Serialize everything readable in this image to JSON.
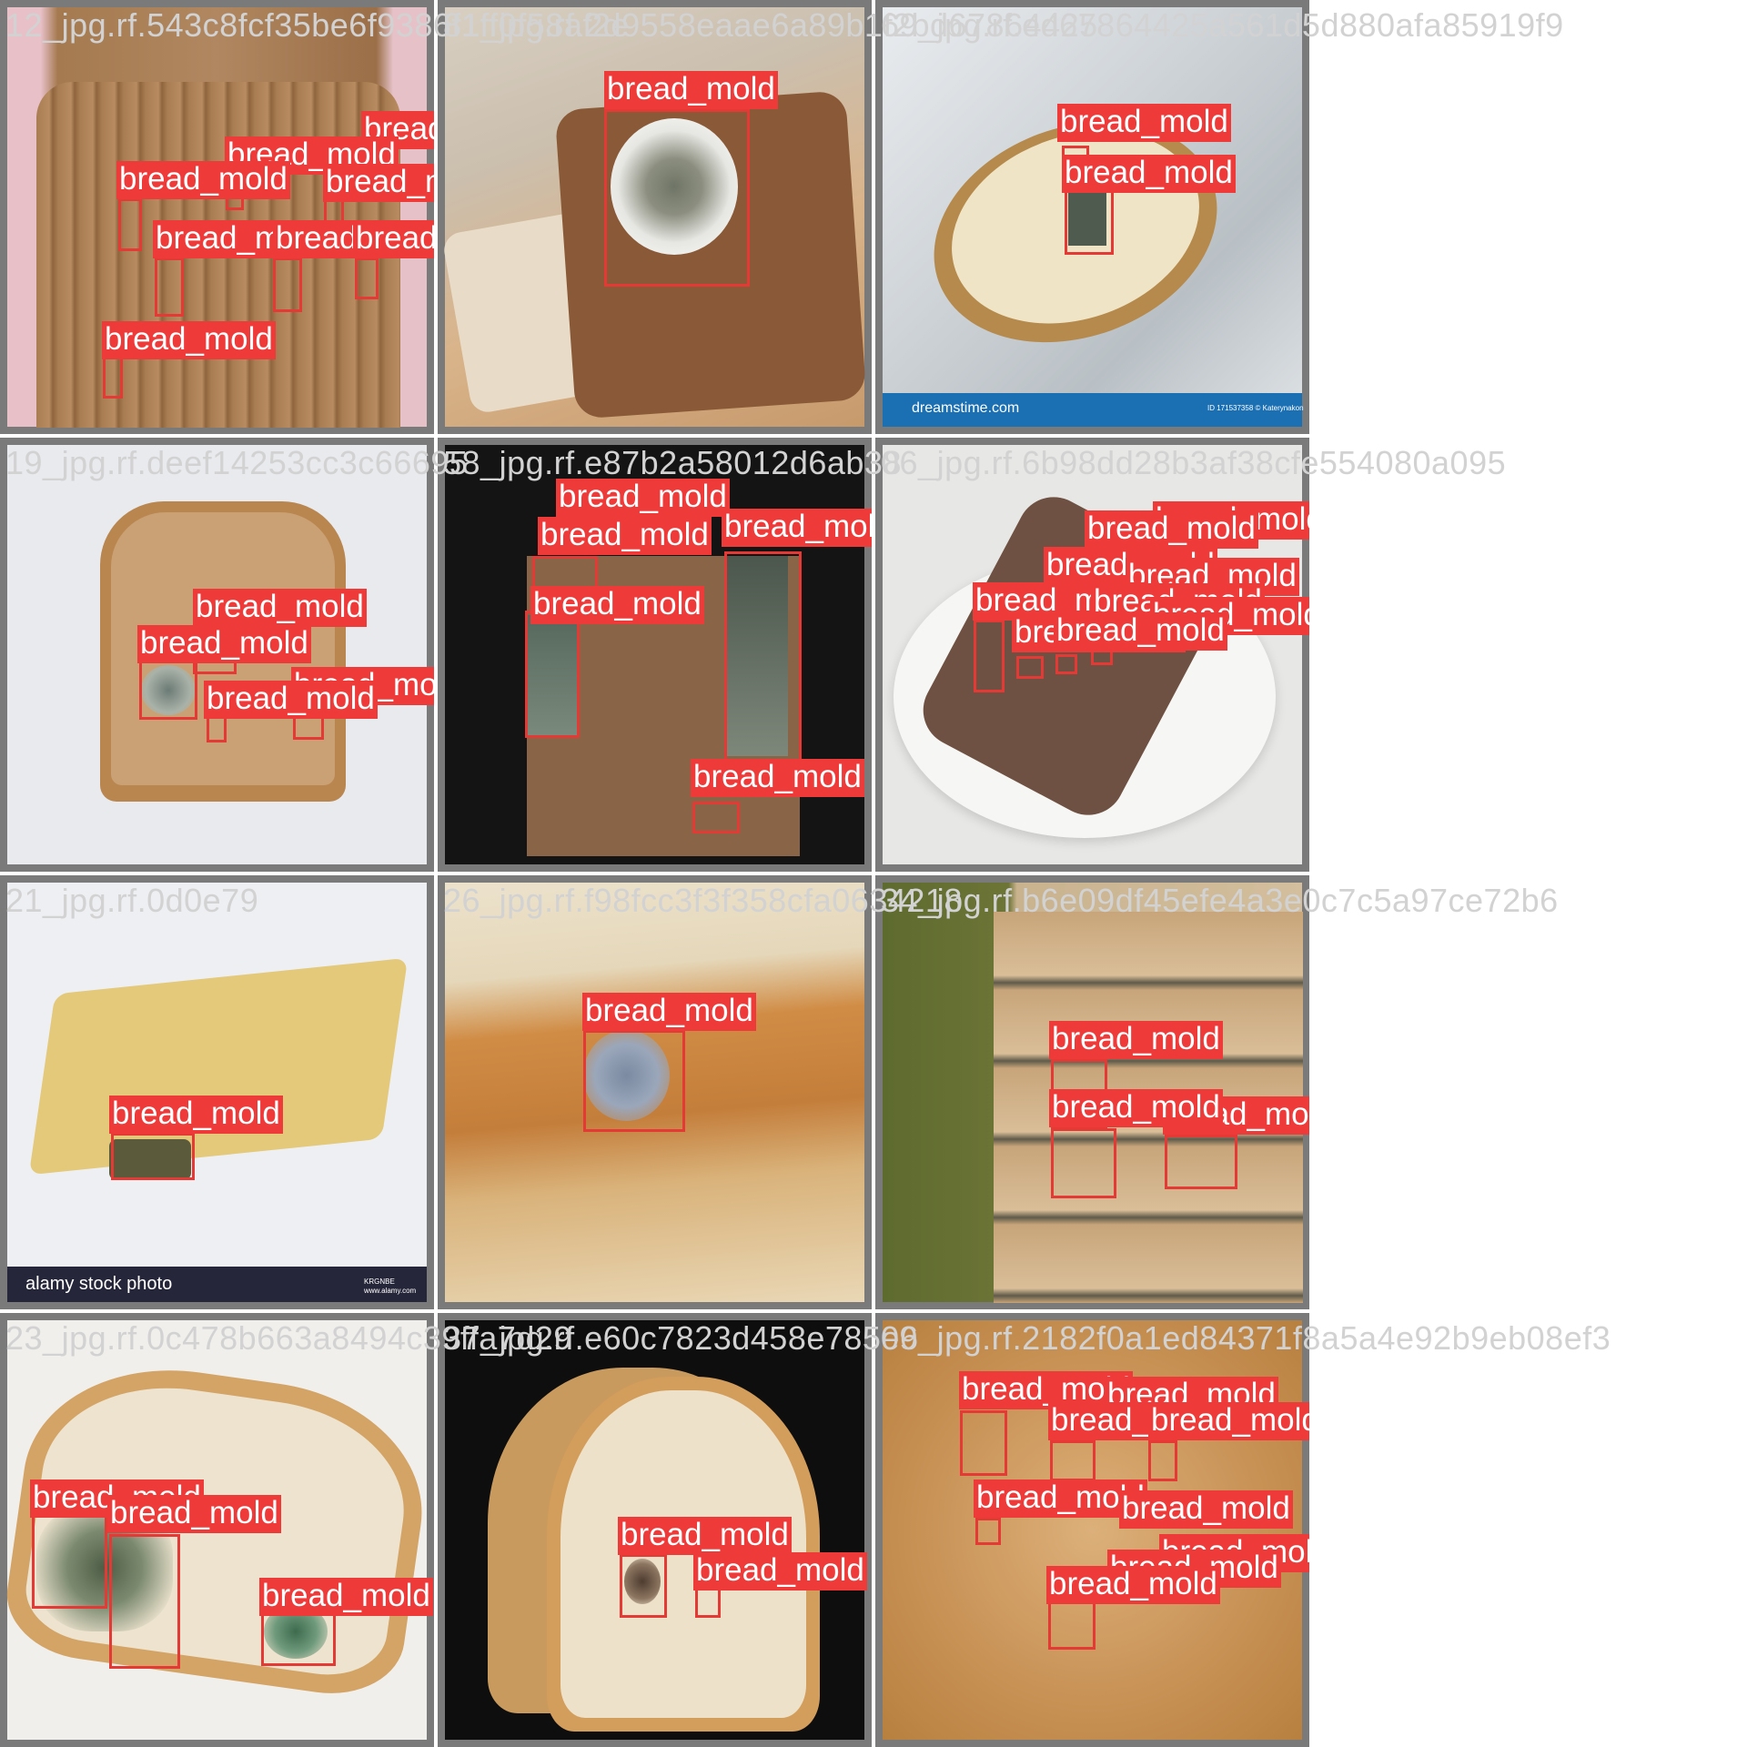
{
  "class_label": "bread_mold",
  "colors": {
    "box": "#e53935",
    "label_bg": "#ef3a3a",
    "label_text": "#ffffff",
    "tile_border": "#7a7a7a"
  },
  "tiles": [
    {
      "filename": "12_jpg.rf.543c8fcf35be6f9386f1ff0f58af2e",
      "scene": "sliced-loaf-pink",
      "boxes": 8
    },
    {
      "filename": "81_jpg.rf.2d9558eaae6a89b1f2bd67864425",
      "scene": "rye-slice-white-mold",
      "boxes": 1
    },
    {
      "filename": "69_jpg.rf.ed67864425a561d5d880afa85919f9",
      "scene": "bread-in-bag",
      "boxes": 2,
      "watermark": "dreamstime.com",
      "watermark_small": "ID 171537358 © Katerynakon"
    },
    {
      "filename": "19_jpg.rf.deef14253cc3c66695",
      "scene": "toast-slice",
      "boxes": 4
    },
    {
      "filename": "58_jpg.rf.e87b2a58012d6ab38",
      "scene": "dark-loaf-side",
      "boxes": 5
    },
    {
      "filename": "06_jpg.rf.6b98dd28b3af38cfe554080a095",
      "scene": "plate-dark-bread",
      "boxes": 9
    },
    {
      "filename": "21_jpg.rf.0d0e79",
      "scene": "white-toast",
      "boxes": 1,
      "watermark": "alamy stock photo",
      "watermark_small": "KRGNBE www.alamy.com"
    },
    {
      "filename": "26_jpg.rf.f98fcc3f3f358cfa0634218",
      "scene": "crust-closeup",
      "boxes": 1
    },
    {
      "filename": "34_jpg.rf.b6e09df45efe4a3e0c7c5a97ce72b6",
      "scene": "stacked-slices",
      "boxes": 3
    },
    {
      "filename": "23_jpg.rf.0c478b663a8494c39ffa7d29",
      "scene": "white-slice-angled",
      "boxes": 3
    },
    {
      "filename": "37_jpg.rf.e60c7823d458e785e6",
      "scene": "slices-black-bg",
      "boxes": 2
    },
    {
      "filename": "09_jpg.rf.2182f0a1ed84371f8a5a4e92b9eb08ef3",
      "scene": "orange-bread",
      "boxes": 11
    }
  ]
}
